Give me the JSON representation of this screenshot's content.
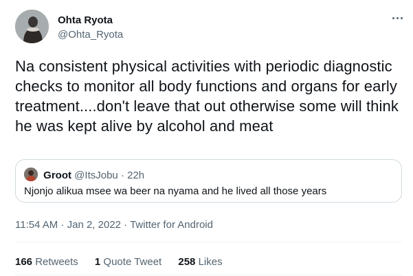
{
  "tweet": {
    "author": {
      "name": "Ohta Ryota",
      "handle": "@Ohta_Ryota"
    },
    "text": "Na consistent physical activities with periodic diagnostic checks to monitor all body functions and organs for early treatment....don't leave that out otherwise some will think he was kept alive by alcohol and meat",
    "more_icon": "more-horizontal-icon"
  },
  "quote": {
    "name": "Groot",
    "handle": "@ItsJobu",
    "separator": "·",
    "time": "22h",
    "text": "Njonjo alikua msee wa beer na nyama and he lived all those years"
  },
  "meta": {
    "time": "11:54 AM",
    "separator1": "·",
    "date": "Jan 2, 2022",
    "separator2": "·",
    "source": "Twitter for Android"
  },
  "stats": {
    "retweets_count": "166",
    "retweets_label": "Retweets",
    "quotes_count": "1",
    "quotes_label": "Quote Tweet",
    "likes_count": "258",
    "likes_label": "Likes"
  },
  "colors": {
    "text": "#0f1419",
    "secondary": "#536471",
    "border": "#cfd9de",
    "divider": "#eff3f4"
  }
}
